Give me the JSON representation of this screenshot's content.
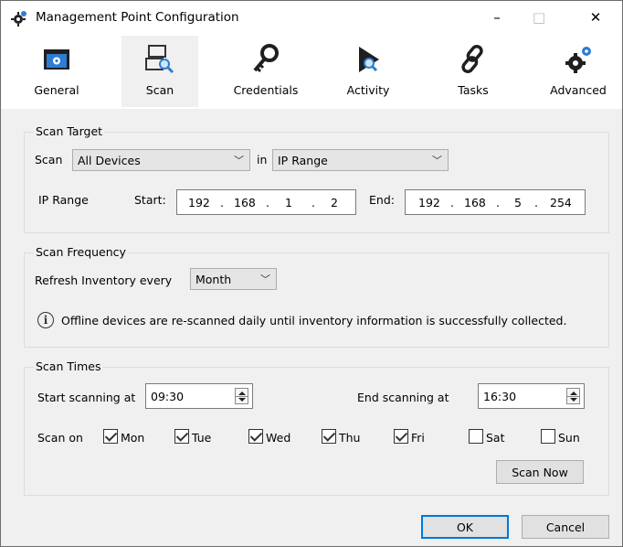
{
  "window": {
    "title": "Management Point Configuration",
    "minimize": "–",
    "maximize": "□",
    "close": "✕"
  },
  "tabs": [
    {
      "label": "General",
      "icon": "general-icon"
    },
    {
      "label": "Scan",
      "icon": "scan-icon",
      "active": true
    },
    {
      "label": "Credentials",
      "icon": "key-icon"
    },
    {
      "label": "Activity",
      "icon": "activity-icon"
    },
    {
      "label": "Tasks",
      "icon": "chain-link-icon"
    },
    {
      "label": "Advanced",
      "icon": "gears-icon"
    }
  ],
  "scan_target": {
    "title": "Scan Target",
    "scan_label": "Scan",
    "scan_value": "All Devices",
    "in_label": "in",
    "in_value": "IP Range",
    "ip_range_label": "IP Range",
    "start_label": "Start:",
    "start_ip": [
      "192",
      "168",
      "1",
      "2"
    ],
    "end_label": "End:",
    "end_ip": [
      "192",
      "168",
      "5",
      "254"
    ],
    "dot": "."
  },
  "scan_frequency": {
    "title": "Scan Frequency",
    "refresh_label": "Refresh Inventory every",
    "refresh_value": "Month",
    "info_text": "Offline devices are re-scanned daily until inventory information is successfully collected."
  },
  "scan_times": {
    "title": "Scan Times",
    "start_label": "Start scanning at",
    "start_value": "09:30",
    "end_label": "End scanning at",
    "end_value": "16:30",
    "scan_on_label": "Scan on",
    "days": [
      {
        "label": "Mon",
        "checked": true
      },
      {
        "label": "Tue",
        "checked": true
      },
      {
        "label": "Wed",
        "checked": true
      },
      {
        "label": "Thu",
        "checked": true
      },
      {
        "label": "Fri",
        "checked": true
      },
      {
        "label": "Sat",
        "checked": false
      },
      {
        "label": "Sun",
        "checked": false
      }
    ],
    "scan_now": "Scan Now"
  },
  "footer": {
    "ok": "OK",
    "cancel": "Cancel"
  },
  "colors": {
    "accent": "#0078d7",
    "panel": "#f0f0f0"
  }
}
